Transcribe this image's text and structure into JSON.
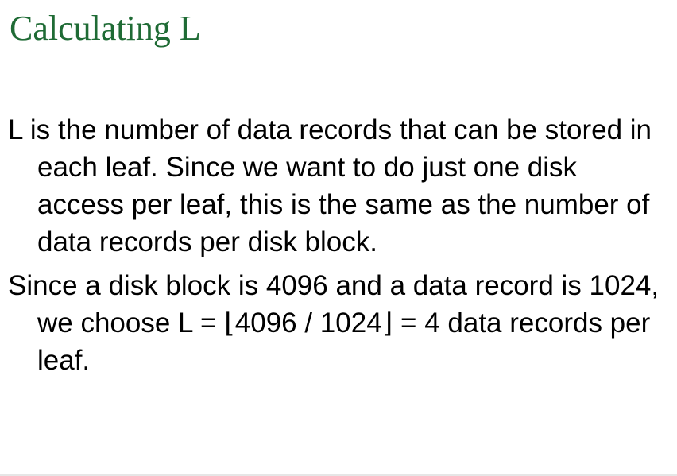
{
  "slide": {
    "title": "Calculating L",
    "paragraphs": [
      "L is the number of data records that can be stored in each leaf.  Since we want to do just one disk access per leaf, this is the same as the number of data records per disk block.",
      "Since a disk block is 4096 and a data record is 1024, we choose L = ⌊4096 / 1024⌋ = 4 data records per leaf."
    ]
  }
}
